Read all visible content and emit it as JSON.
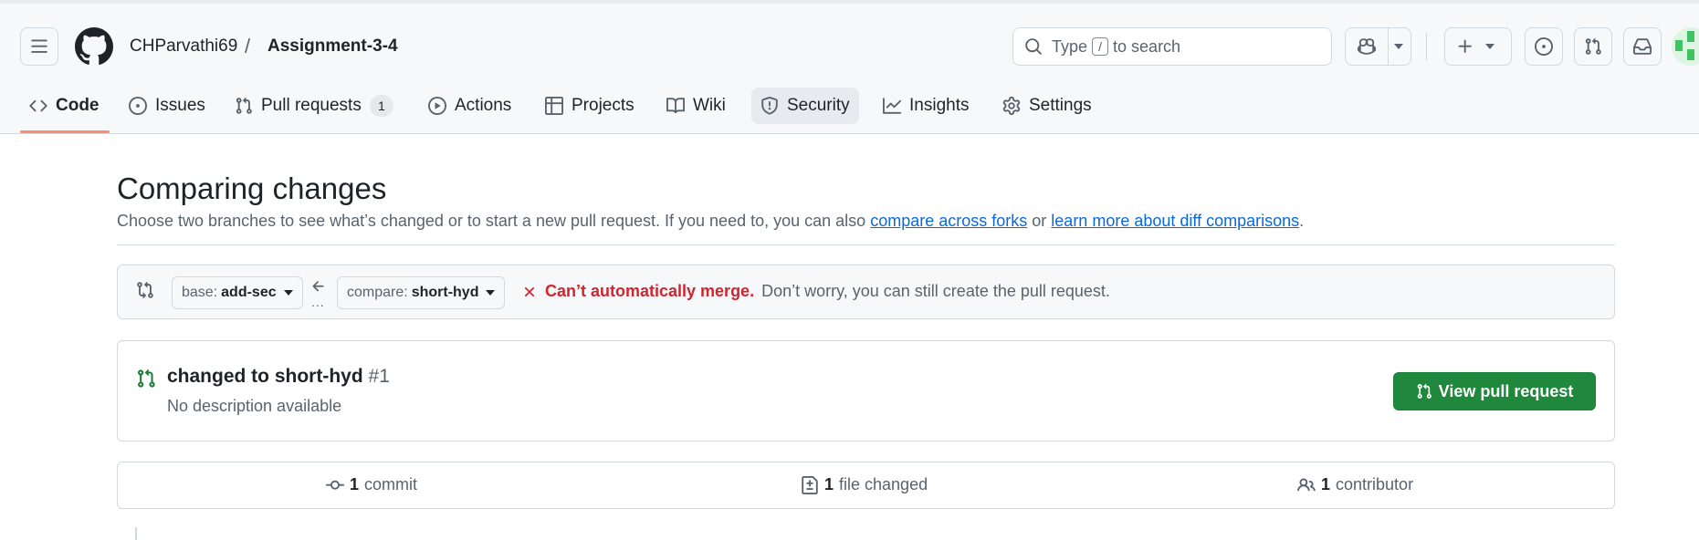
{
  "header": {
    "owner": "CHParvathi69",
    "separator": "/",
    "repo": "Assignment-3-4",
    "search": {
      "prefix": "Type",
      "key": "/",
      "suffix": "to search"
    },
    "icons": [
      "hamburger-icon",
      "github-logo",
      "search-icon",
      "copilot-icon",
      "plus-icon",
      "issues-icon",
      "pull-request-icon",
      "inbox-icon"
    ]
  },
  "tabs": [
    {
      "label": "Code",
      "icon": "code-icon",
      "active": true
    },
    {
      "label": "Issues",
      "icon": "issue-opened-icon"
    },
    {
      "label": "Pull requests",
      "icon": "git-pull-request-icon",
      "counter": "1"
    },
    {
      "label": "Actions",
      "icon": "play-icon"
    },
    {
      "label": "Projects",
      "icon": "table-icon"
    },
    {
      "label": "Wiki",
      "icon": "book-icon"
    },
    {
      "label": "Security",
      "icon": "shield-icon"
    },
    {
      "label": "Insights",
      "icon": "graph-icon"
    },
    {
      "label": "Settings",
      "icon": "gear-icon"
    }
  ],
  "compare": {
    "title": "Comparing changes",
    "subtitle_before": "Choose two branches to see what’s changed or to start a new pull request. If you need to, you can also",
    "link_forks": "compare across forks",
    "subtitle_or": "or",
    "link_learn": "learn more about diff comparisons",
    "subtitle_end": ".",
    "base_prefix": "base:",
    "base_branch": "add-sec",
    "compare_prefix": "compare:",
    "compare_branch": "short-hyd",
    "dots": "...",
    "merge_bad": "Can’t automatically merge.",
    "merge_ok": "Don’t worry, you can still create the pull request."
  },
  "pull_request": {
    "title": "changed to short-hyd",
    "number": "#1",
    "description": "No description available",
    "button": "View pull request"
  },
  "stats": {
    "commits_count": "1",
    "commits_label": "commit",
    "files_count": "1",
    "files_label": "file changed",
    "contributors_count": "1",
    "contributors_label": "contributor"
  },
  "colors": {
    "accent_green": "#1f883d",
    "danger_red": "#d1242f",
    "link_blue": "#0969da",
    "tab_underline": "#fd8c73"
  }
}
